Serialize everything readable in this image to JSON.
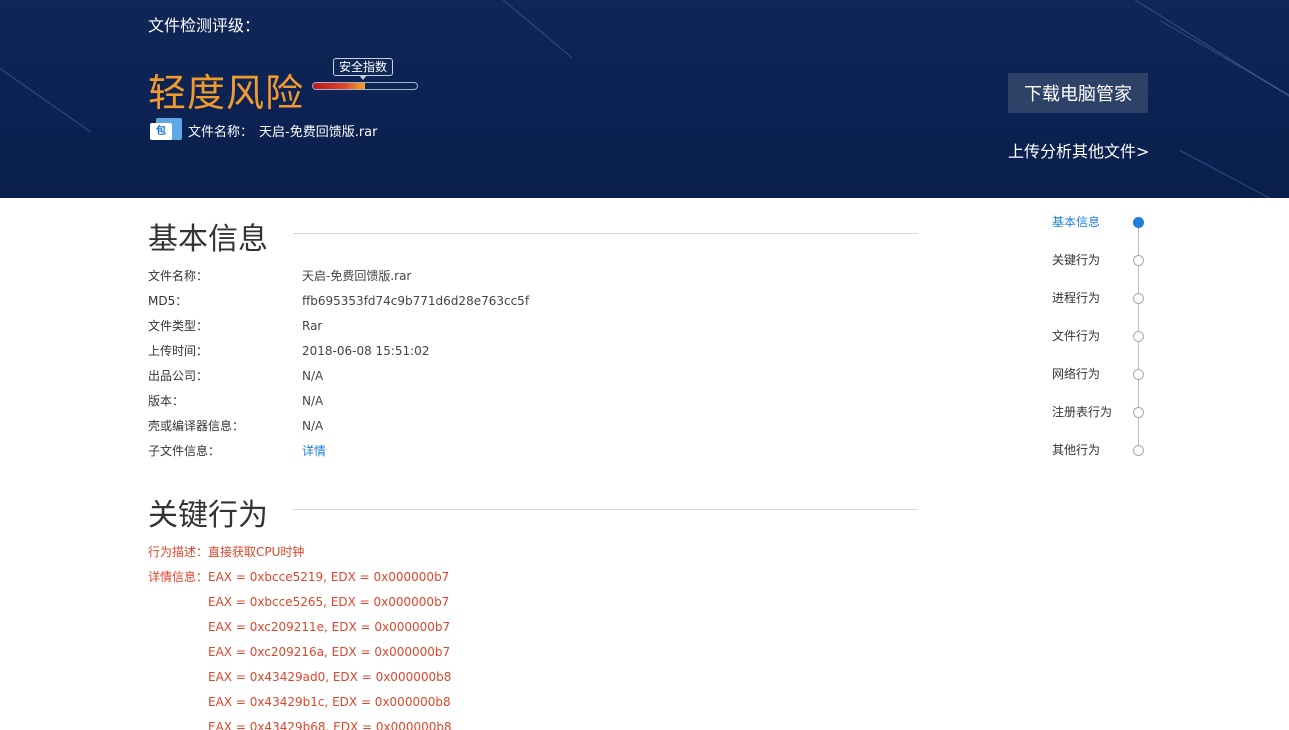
{
  "header": {
    "title": "文件检测评级：",
    "risk_level": "轻度风险",
    "gauge_label": "安全指数",
    "gauge_fill_fraction": 0.5,
    "file_icon_text": "包",
    "file_name_label": "文件名称：",
    "file_name_value": "天启-免费回馈版.rar",
    "download_button": "下载电脑管家",
    "upload_link": "上传分析其他文件>"
  },
  "basic_info": {
    "title": "基本信息",
    "rows": [
      {
        "label": "文件名称：",
        "value": "天启-免费回馈版.rar"
      },
      {
        "label": "MD5：",
        "value": "ffb695353fd74c9b771d6d28e763cc5f"
      },
      {
        "label": "文件类型：",
        "value": "Rar"
      },
      {
        "label": "上传时间：",
        "value": "2018-06-08 15:51:02"
      },
      {
        "label": "出品公司：",
        "value": "N/A"
      },
      {
        "label": "版本：",
        "value": "N/A"
      },
      {
        "label": "壳或编译器信息：",
        "value": "N/A"
      },
      {
        "label": "子文件信息：",
        "value": "详情"
      }
    ]
  },
  "key_behavior": {
    "title": "关键行为",
    "description_label": "行为描述：",
    "description_value": "直接获取CPU时钟",
    "detail_label": "详情信息：",
    "details": [
      "EAX = 0xbcce5219, EDX = 0x000000b7",
      "EAX = 0xbcce5265, EDX = 0x000000b7",
      "EAX = 0xc209211e, EDX = 0x000000b7",
      "EAX = 0xc209216a, EDX = 0x000000b7",
      "EAX = 0x43429ad0, EDX = 0x000000b8",
      "EAX = 0x43429b1c, EDX = 0x000000b8",
      "EAX = 0x43429b68, EDX = 0x000000b8"
    ]
  },
  "nav": {
    "items": [
      {
        "label": "基本信息",
        "active": true
      },
      {
        "label": "关键行为",
        "active": false
      },
      {
        "label": "进程行为",
        "active": false
      },
      {
        "label": "文件行为",
        "active": false
      },
      {
        "label": "网络行为",
        "active": false
      },
      {
        "label": "注册表行为",
        "active": false
      },
      {
        "label": "其他行为",
        "active": false
      }
    ]
  },
  "colors": {
    "banner": "#0f2757",
    "risk": "#f39a2e",
    "accent": "#1e7fd8",
    "behavior_text": "#e0452a"
  }
}
